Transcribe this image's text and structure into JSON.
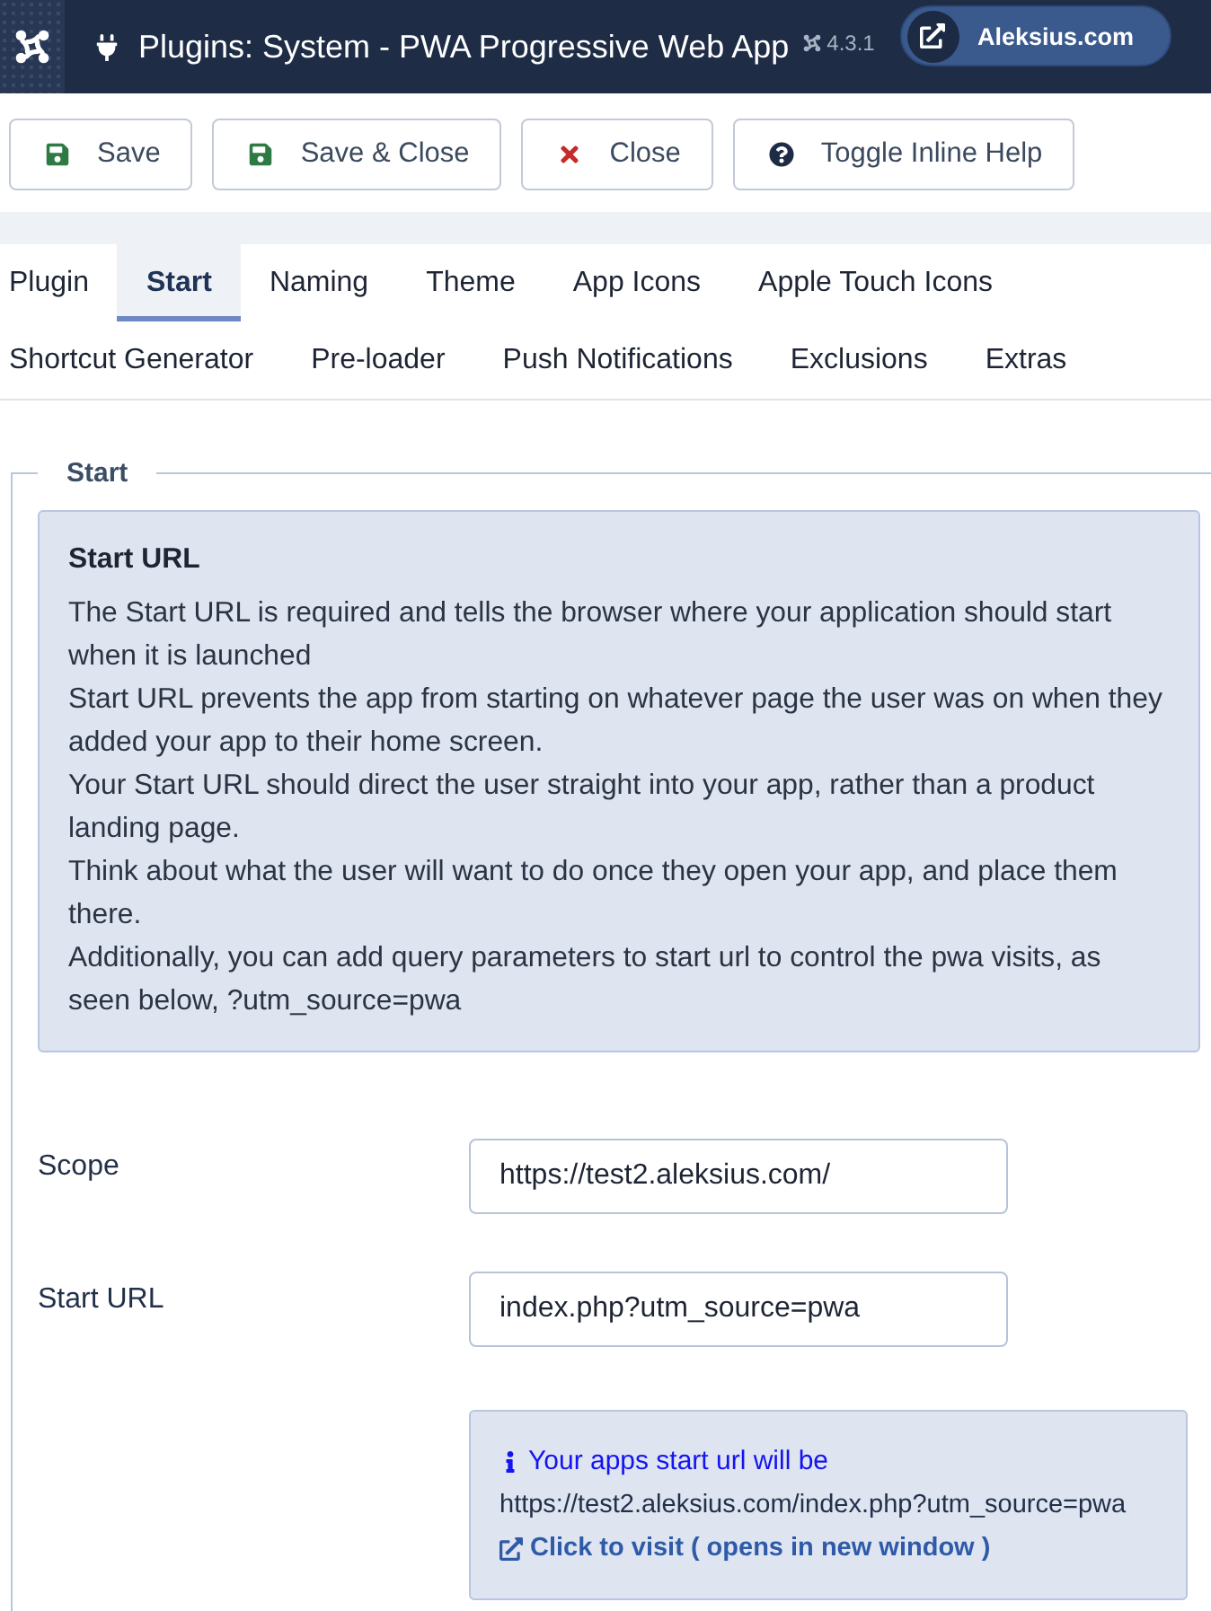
{
  "header": {
    "title": "Plugins: System - PWA Progressive Web App",
    "version": "4.3.1",
    "site_link": "Aleksius.com"
  },
  "toolbar": [
    {
      "label": "Save",
      "kind": "save"
    },
    {
      "label": "Save & Close",
      "kind": "save"
    },
    {
      "label": "Close",
      "kind": "close"
    },
    {
      "label": "Toggle Inline Help",
      "kind": "help"
    }
  ],
  "tabs": [
    {
      "label": "Plugin",
      "selected": false
    },
    {
      "label": "Start",
      "selected": true
    },
    {
      "label": "Naming",
      "selected": false
    },
    {
      "label": "Theme",
      "selected": false
    },
    {
      "label": "App Icons",
      "selected": false
    },
    {
      "label": "Apple Touch Icons",
      "selected": false
    },
    {
      "label": "Shortcut Generator",
      "selected": false
    },
    {
      "label": "Pre-loader",
      "selected": false
    },
    {
      "label": "Push Notifications",
      "selected": false
    },
    {
      "label": "Exclusions",
      "selected": false
    },
    {
      "label": "Extras",
      "selected": false
    }
  ],
  "fieldset": {
    "legend": "Start",
    "notice": {
      "title": "Start URL",
      "lines": [
        "The Start URL is required and tells the browser where your application should start when it is launched",
        "Start URL prevents the app from starting on whatever page the user was on when they added your app to their home screen.",
        "Your Start URL should direct the user straight into your app, rather than a product landing page.",
        "Think about what the user will want to do once they open your app, and place them there.",
        "Additionally, you can add query parameters to start url to control the pwa visits, as seen below, ?utm_source=pwa"
      ]
    },
    "fields": [
      {
        "label": "Scope",
        "value": "https://test2.aleksius.com/"
      },
      {
        "label": "Start URL",
        "value": "index.php?utm_source=pwa"
      }
    ],
    "start_url_info": {
      "heading": "Your apps start url will be",
      "url": "https://test2.aleksius.com/index.php?utm_source=pwa",
      "link": "Click to visit ( opens in new window )"
    }
  }
}
